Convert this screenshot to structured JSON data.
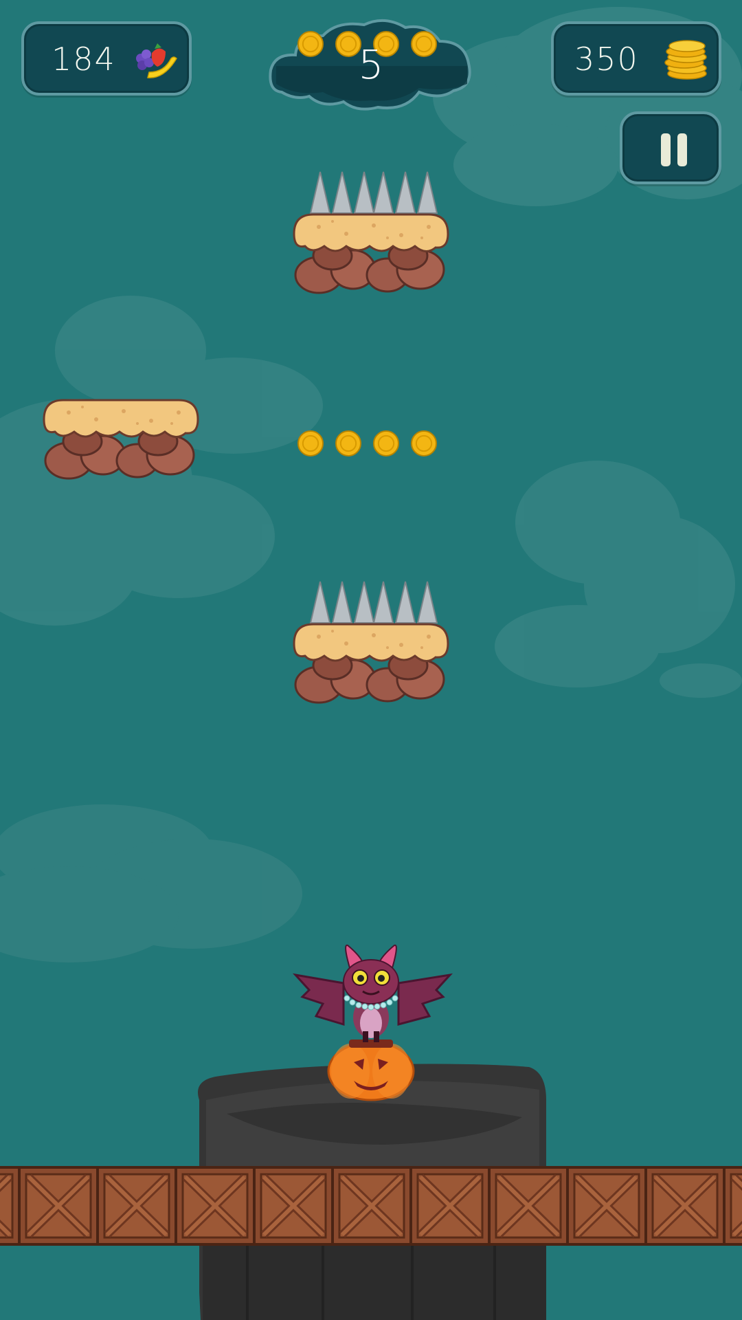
{
  "hud": {
    "fruit_count": "184",
    "coin_count": "350",
    "level": "5",
    "level_coins_collected": 4
  },
  "icons": {
    "fruit": "fruit-bundle-icon",
    "coins": "coin-stack-icon",
    "pause": "pause-icon",
    "coin": "coin-icon"
  },
  "colors": {
    "sky": "#227878",
    "panel": "#114852",
    "panel_border": "#5f9aa2",
    "coin": "#f3b613",
    "cake_top": "#f2c77f",
    "rock": "#a65e4d",
    "crate": "#8a4a2e",
    "pillar": "#3a3a3a",
    "bat": "#8a2f55",
    "pumpkin": "#f07a1a"
  }
}
